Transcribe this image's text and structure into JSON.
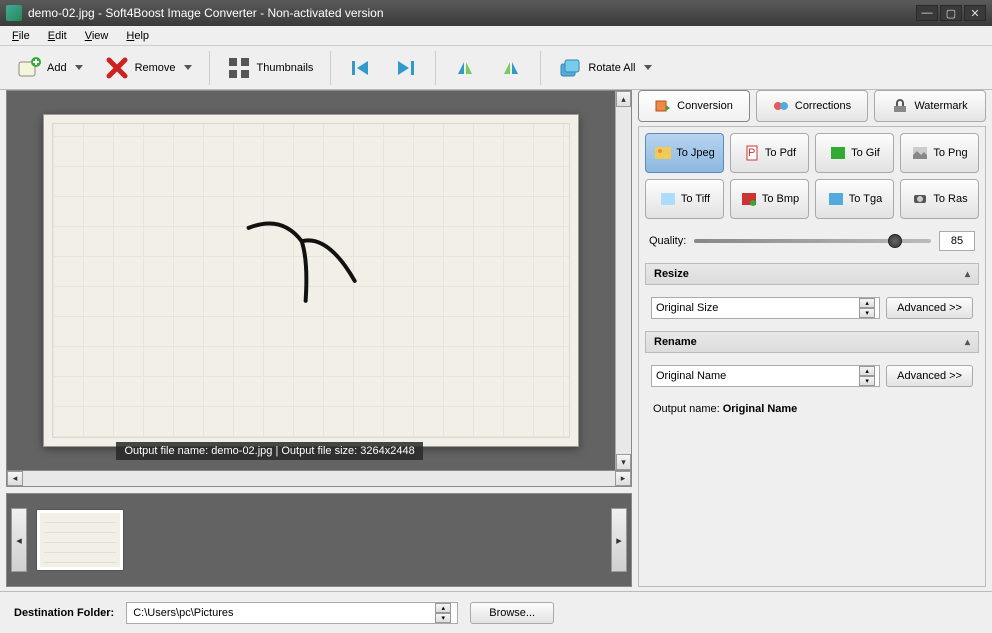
{
  "title": "demo-02.jpg - Soft4Boost Image Converter - Non-activated version",
  "menu": {
    "file": "File",
    "edit": "Edit",
    "view": "View",
    "help": "Help"
  },
  "toolbar": {
    "add": "Add",
    "remove": "Remove",
    "thumbs": "Thumbnails",
    "rotate": "Rotate All"
  },
  "tabs": {
    "conversion": "Conversion",
    "corrections": "Corrections",
    "watermark": "Watermark"
  },
  "formats": {
    "jpeg": "To Jpeg",
    "pdf": "To Pdf",
    "gif": "To Gif",
    "png": "To Png",
    "tiff": "To Tiff",
    "bmp": "To Bmp",
    "tga": "To Tga",
    "ras": "To Ras"
  },
  "quality": {
    "label": "Quality:",
    "value": "85",
    "pct": 85
  },
  "resize": {
    "head": "Resize",
    "value": "Original Size",
    "adv": "Advanced >>"
  },
  "rename": {
    "head": "Rename",
    "value": "Original Name",
    "adv": "Advanced >>",
    "outlabel": "Output name:",
    "outval": "Original Name"
  },
  "overlay": "Output file name: demo-02.jpg | Output file size: 3264x2448",
  "dest": {
    "label": "Destination Folder:",
    "path": "C:\\Users\\pc\\Pictures",
    "browse": "Browse..."
  }
}
